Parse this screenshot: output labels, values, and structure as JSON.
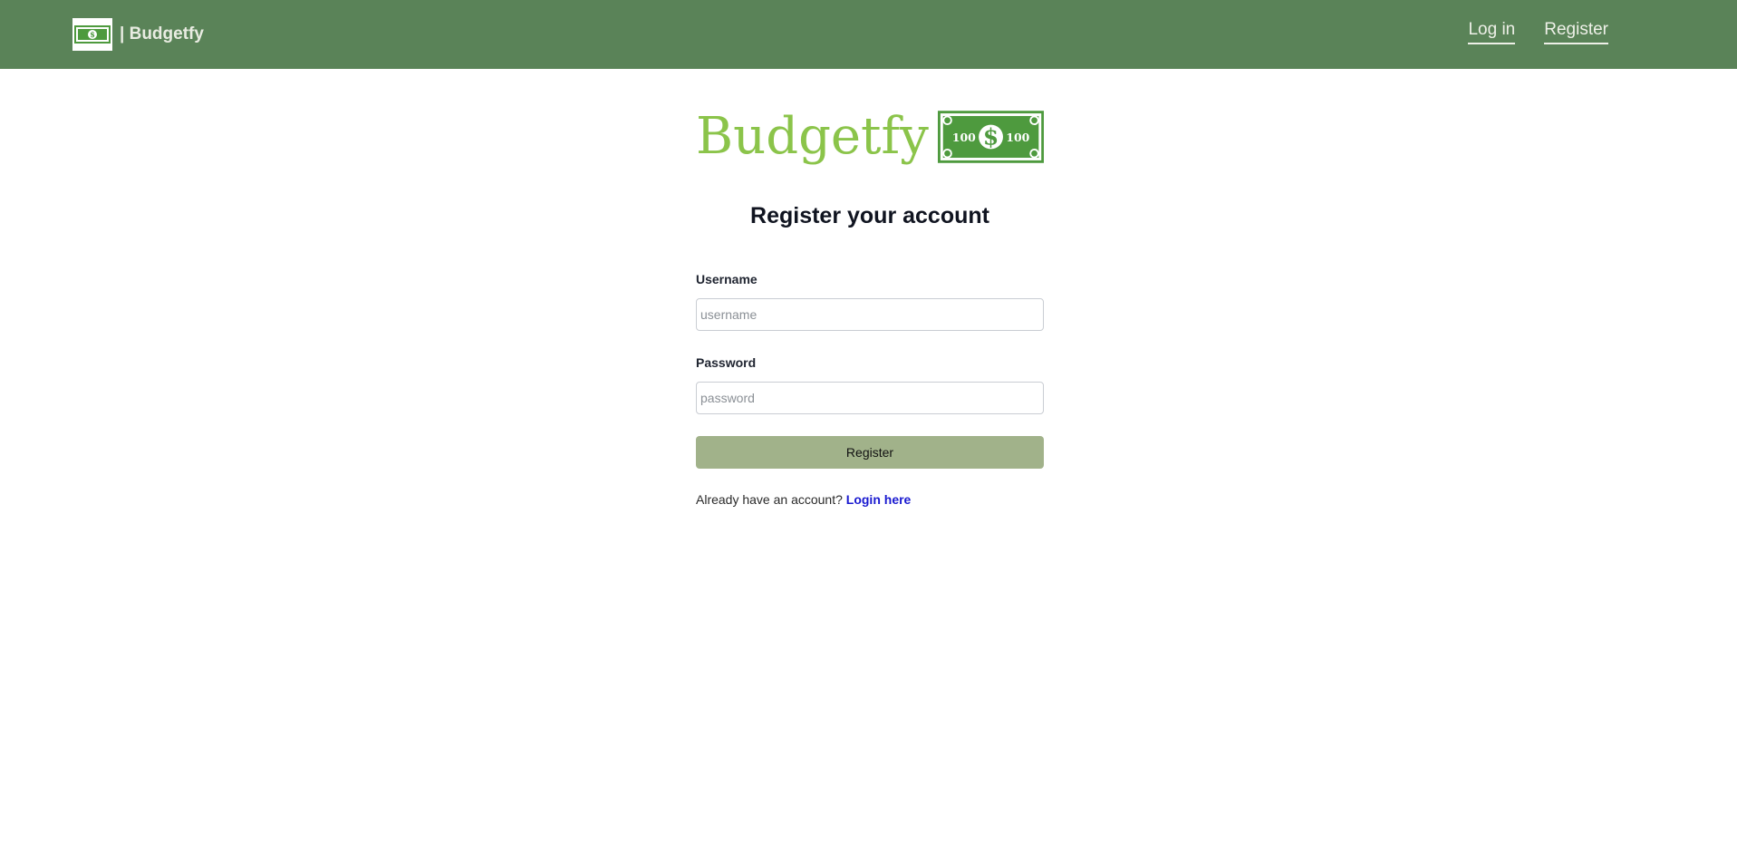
{
  "navbar": {
    "brand_text": "| Budgetfy",
    "links": [
      {
        "label": "Log in"
      },
      {
        "label": "Register"
      }
    ]
  },
  "hero": {
    "title": "Budgetfy",
    "bill_values": [
      "100",
      "100"
    ]
  },
  "form": {
    "heading": "Register your account",
    "username_label": "Username",
    "username_placeholder": "username",
    "password_label": "Password",
    "password_placeholder": "password",
    "submit_label": "Register",
    "footer_text": "Already have an account?",
    "footer_link": "Login here"
  },
  "colors": {
    "navbar_bg": "#5a8358",
    "brand_green": "#8bc44a",
    "bill_green": "#4e9a3e",
    "button_bg": "#a1b28a",
    "link_blue": "#1a1ad0"
  }
}
